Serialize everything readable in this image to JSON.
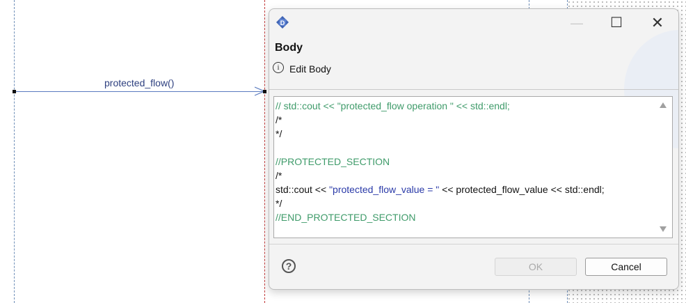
{
  "diagram": {
    "message_label": "protected_flow()"
  },
  "dialog": {
    "app_icon": "papyrus-app-icon",
    "window_buttons": {
      "minimize": "—",
      "maximize": "☐",
      "close": "✕"
    },
    "title": "Body",
    "message_icon": "info-icon",
    "message": "Edit Body",
    "code_lines": [
      {
        "text": "// std::cout << \"protected_flow operation \" << std::endl;",
        "style": "green"
      },
      {
        "text": "/*",
        "style": "plain"
      },
      {
        "text": "*/",
        "style": "plain"
      },
      {
        "text": "",
        "style": "plain"
      },
      {
        "text": "//PROTECTED_SECTION",
        "style": "green"
      },
      {
        "text": "/*",
        "style": "plain"
      },
      {
        "pre": "std::cout << ",
        "str": "\"protected_flow_value = \"",
        "post": " << protected_flow_value << std::endl;",
        "style": "mixed"
      },
      {
        "text": "*/",
        "style": "plain"
      },
      {
        "text": "//END_PROTECTED_SECTION",
        "style": "green"
      }
    ],
    "help_icon": "help-icon",
    "buttons": {
      "ok": "OK",
      "cancel": "Cancel"
    },
    "ok_enabled": false
  }
}
